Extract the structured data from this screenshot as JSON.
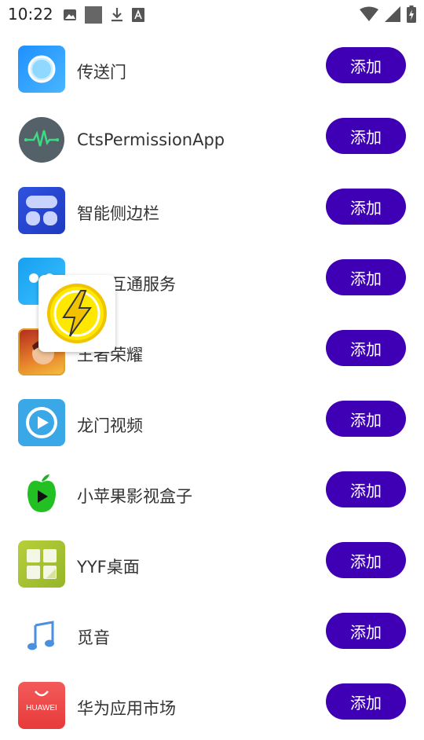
{
  "status_bar": {
    "time": "10:22",
    "left_icons": [
      "image-icon",
      "square-icon",
      "download-icon",
      "font-icon"
    ],
    "right_icons": [
      "wifi-icon",
      "signal-icon",
      "battery-icon"
    ]
  },
  "apps": [
    {
      "name": "传送门",
      "icon": "portal-icon",
      "button": "添加"
    },
    {
      "name": "CtsPermissionApp",
      "icon": "heartbeat-icon",
      "button": "添加"
    },
    {
      "name": "智能侧边栏",
      "icon": "sidebar-icon",
      "button": "添加"
    },
    {
      "name": "智慧互通服务",
      "icon": "interconnect-icon",
      "button": "添加"
    },
    {
      "name": "王者荣耀",
      "icon": "game-icon",
      "button": "添加"
    },
    {
      "name": "龙门视频",
      "icon": "video-play-icon",
      "button": "添加"
    },
    {
      "name": "小苹果影视盒子",
      "icon": "apple-play-icon",
      "button": "添加"
    },
    {
      "name": "YYF桌面",
      "icon": "grid-launcher-icon",
      "button": "添加"
    },
    {
      "name": "觅音",
      "icon": "music-note-icon",
      "button": "添加"
    },
    {
      "name": "华为应用市场",
      "icon": "huawei-appgallery-icon",
      "button": "添加",
      "icon_text": "HUAWEI"
    }
  ],
  "floating_widget": {
    "icon": "lightning-bolt-icon"
  },
  "colors": {
    "button_bg": "#3f00b5",
    "button_text": "#ffffff",
    "text": "#333333"
  }
}
